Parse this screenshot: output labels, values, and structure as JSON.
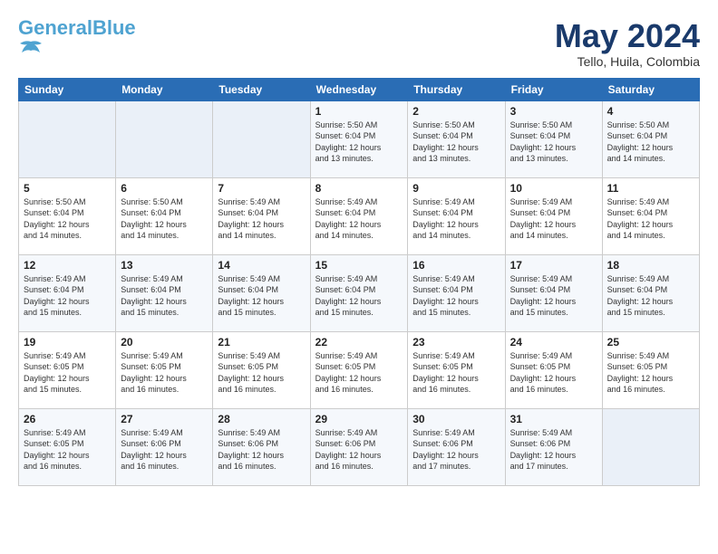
{
  "header": {
    "logo_main": "General",
    "logo_accent": "Blue",
    "month": "May 2024",
    "location": "Tello, Huila, Colombia"
  },
  "weekdays": [
    "Sunday",
    "Monday",
    "Tuesday",
    "Wednesday",
    "Thursday",
    "Friday",
    "Saturday"
  ],
  "weeks": [
    [
      {
        "day": "",
        "info": ""
      },
      {
        "day": "",
        "info": ""
      },
      {
        "day": "",
        "info": ""
      },
      {
        "day": "1",
        "info": "Sunrise: 5:50 AM\nSunset: 6:04 PM\nDaylight: 12 hours\nand 13 minutes."
      },
      {
        "day": "2",
        "info": "Sunrise: 5:50 AM\nSunset: 6:04 PM\nDaylight: 12 hours\nand 13 minutes."
      },
      {
        "day": "3",
        "info": "Sunrise: 5:50 AM\nSunset: 6:04 PM\nDaylight: 12 hours\nand 13 minutes."
      },
      {
        "day": "4",
        "info": "Sunrise: 5:50 AM\nSunset: 6:04 PM\nDaylight: 12 hours\nand 14 minutes."
      }
    ],
    [
      {
        "day": "5",
        "info": "Sunrise: 5:50 AM\nSunset: 6:04 PM\nDaylight: 12 hours\nand 14 minutes."
      },
      {
        "day": "6",
        "info": "Sunrise: 5:50 AM\nSunset: 6:04 PM\nDaylight: 12 hours\nand 14 minutes."
      },
      {
        "day": "7",
        "info": "Sunrise: 5:49 AM\nSunset: 6:04 PM\nDaylight: 12 hours\nand 14 minutes."
      },
      {
        "day": "8",
        "info": "Sunrise: 5:49 AM\nSunset: 6:04 PM\nDaylight: 12 hours\nand 14 minutes."
      },
      {
        "day": "9",
        "info": "Sunrise: 5:49 AM\nSunset: 6:04 PM\nDaylight: 12 hours\nand 14 minutes."
      },
      {
        "day": "10",
        "info": "Sunrise: 5:49 AM\nSunset: 6:04 PM\nDaylight: 12 hours\nand 14 minutes."
      },
      {
        "day": "11",
        "info": "Sunrise: 5:49 AM\nSunset: 6:04 PM\nDaylight: 12 hours\nand 14 minutes."
      }
    ],
    [
      {
        "day": "12",
        "info": "Sunrise: 5:49 AM\nSunset: 6:04 PM\nDaylight: 12 hours\nand 15 minutes."
      },
      {
        "day": "13",
        "info": "Sunrise: 5:49 AM\nSunset: 6:04 PM\nDaylight: 12 hours\nand 15 minutes."
      },
      {
        "day": "14",
        "info": "Sunrise: 5:49 AM\nSunset: 6:04 PM\nDaylight: 12 hours\nand 15 minutes."
      },
      {
        "day": "15",
        "info": "Sunrise: 5:49 AM\nSunset: 6:04 PM\nDaylight: 12 hours\nand 15 minutes."
      },
      {
        "day": "16",
        "info": "Sunrise: 5:49 AM\nSunset: 6:04 PM\nDaylight: 12 hours\nand 15 minutes."
      },
      {
        "day": "17",
        "info": "Sunrise: 5:49 AM\nSunset: 6:04 PM\nDaylight: 12 hours\nand 15 minutes."
      },
      {
        "day": "18",
        "info": "Sunrise: 5:49 AM\nSunset: 6:04 PM\nDaylight: 12 hours\nand 15 minutes."
      }
    ],
    [
      {
        "day": "19",
        "info": "Sunrise: 5:49 AM\nSunset: 6:05 PM\nDaylight: 12 hours\nand 15 minutes."
      },
      {
        "day": "20",
        "info": "Sunrise: 5:49 AM\nSunset: 6:05 PM\nDaylight: 12 hours\nand 16 minutes."
      },
      {
        "day": "21",
        "info": "Sunrise: 5:49 AM\nSunset: 6:05 PM\nDaylight: 12 hours\nand 16 minutes."
      },
      {
        "day": "22",
        "info": "Sunrise: 5:49 AM\nSunset: 6:05 PM\nDaylight: 12 hours\nand 16 minutes."
      },
      {
        "day": "23",
        "info": "Sunrise: 5:49 AM\nSunset: 6:05 PM\nDaylight: 12 hours\nand 16 minutes."
      },
      {
        "day": "24",
        "info": "Sunrise: 5:49 AM\nSunset: 6:05 PM\nDaylight: 12 hours\nand 16 minutes."
      },
      {
        "day": "25",
        "info": "Sunrise: 5:49 AM\nSunset: 6:05 PM\nDaylight: 12 hours\nand 16 minutes."
      }
    ],
    [
      {
        "day": "26",
        "info": "Sunrise: 5:49 AM\nSunset: 6:05 PM\nDaylight: 12 hours\nand 16 minutes."
      },
      {
        "day": "27",
        "info": "Sunrise: 5:49 AM\nSunset: 6:06 PM\nDaylight: 12 hours\nand 16 minutes."
      },
      {
        "day": "28",
        "info": "Sunrise: 5:49 AM\nSunset: 6:06 PM\nDaylight: 12 hours\nand 16 minutes."
      },
      {
        "day": "29",
        "info": "Sunrise: 5:49 AM\nSunset: 6:06 PM\nDaylight: 12 hours\nand 16 minutes."
      },
      {
        "day": "30",
        "info": "Sunrise: 5:49 AM\nSunset: 6:06 PM\nDaylight: 12 hours\nand 17 minutes."
      },
      {
        "day": "31",
        "info": "Sunrise: 5:49 AM\nSunset: 6:06 PM\nDaylight: 12 hours\nand 17 minutes."
      },
      {
        "day": "",
        "info": ""
      }
    ]
  ]
}
